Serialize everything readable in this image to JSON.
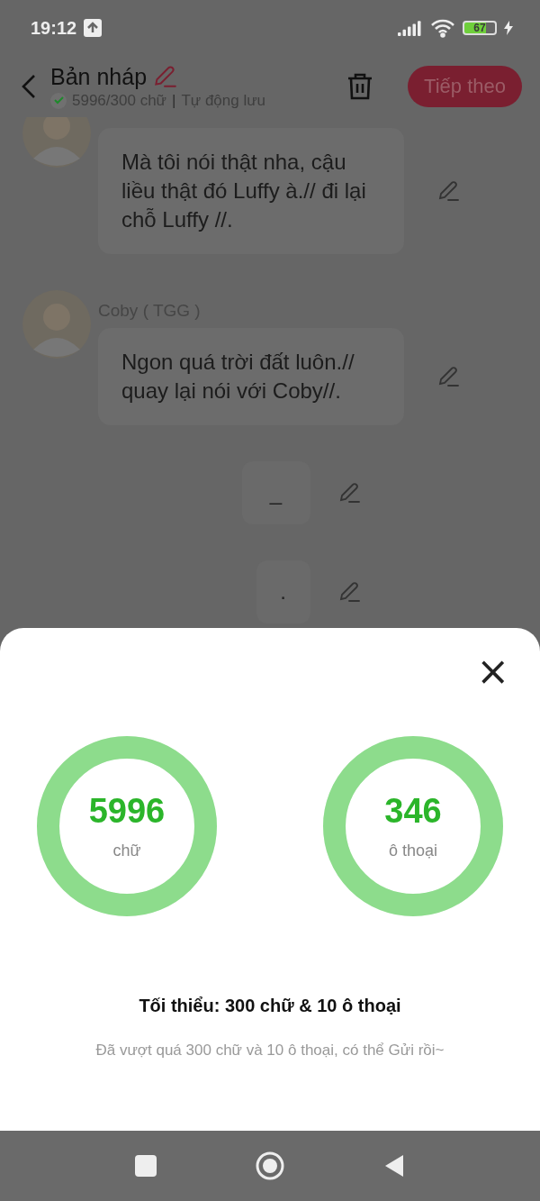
{
  "status_bar": {
    "time": "19:12",
    "battery": "67"
  },
  "header": {
    "title": "Bản nháp",
    "progress": "5996/300 chữ",
    "separator": "|",
    "autosave": "Tự động lưu",
    "saved": true,
    "next_button": "Tiếp theo"
  },
  "messages": [
    {
      "kind": "dialogue",
      "text": "Mà tôi nói thật nha, cậu liều thật đó Luffy à.// đi lại chỗ Luffy //."
    },
    {
      "kind": "dialogue",
      "name": "Coby ( TGG )",
      "text": "Ngon quá trời đất luôn.// quay lại nói với Coby//."
    },
    {
      "kind": "narration",
      "text": "_"
    },
    {
      "kind": "narration",
      "text": "."
    }
  ],
  "sheet": {
    "close": "×",
    "rings": [
      {
        "value": "5996",
        "unit": "chữ"
      },
      {
        "value": "346",
        "unit": "ô thoại"
      }
    ],
    "requirement": "Tối thiểu: 300 chữ & 10 ô thoại",
    "note": "Đã vượt quá 300 chữ và 10 ô thoại, có thể Gửi rồi~"
  }
}
